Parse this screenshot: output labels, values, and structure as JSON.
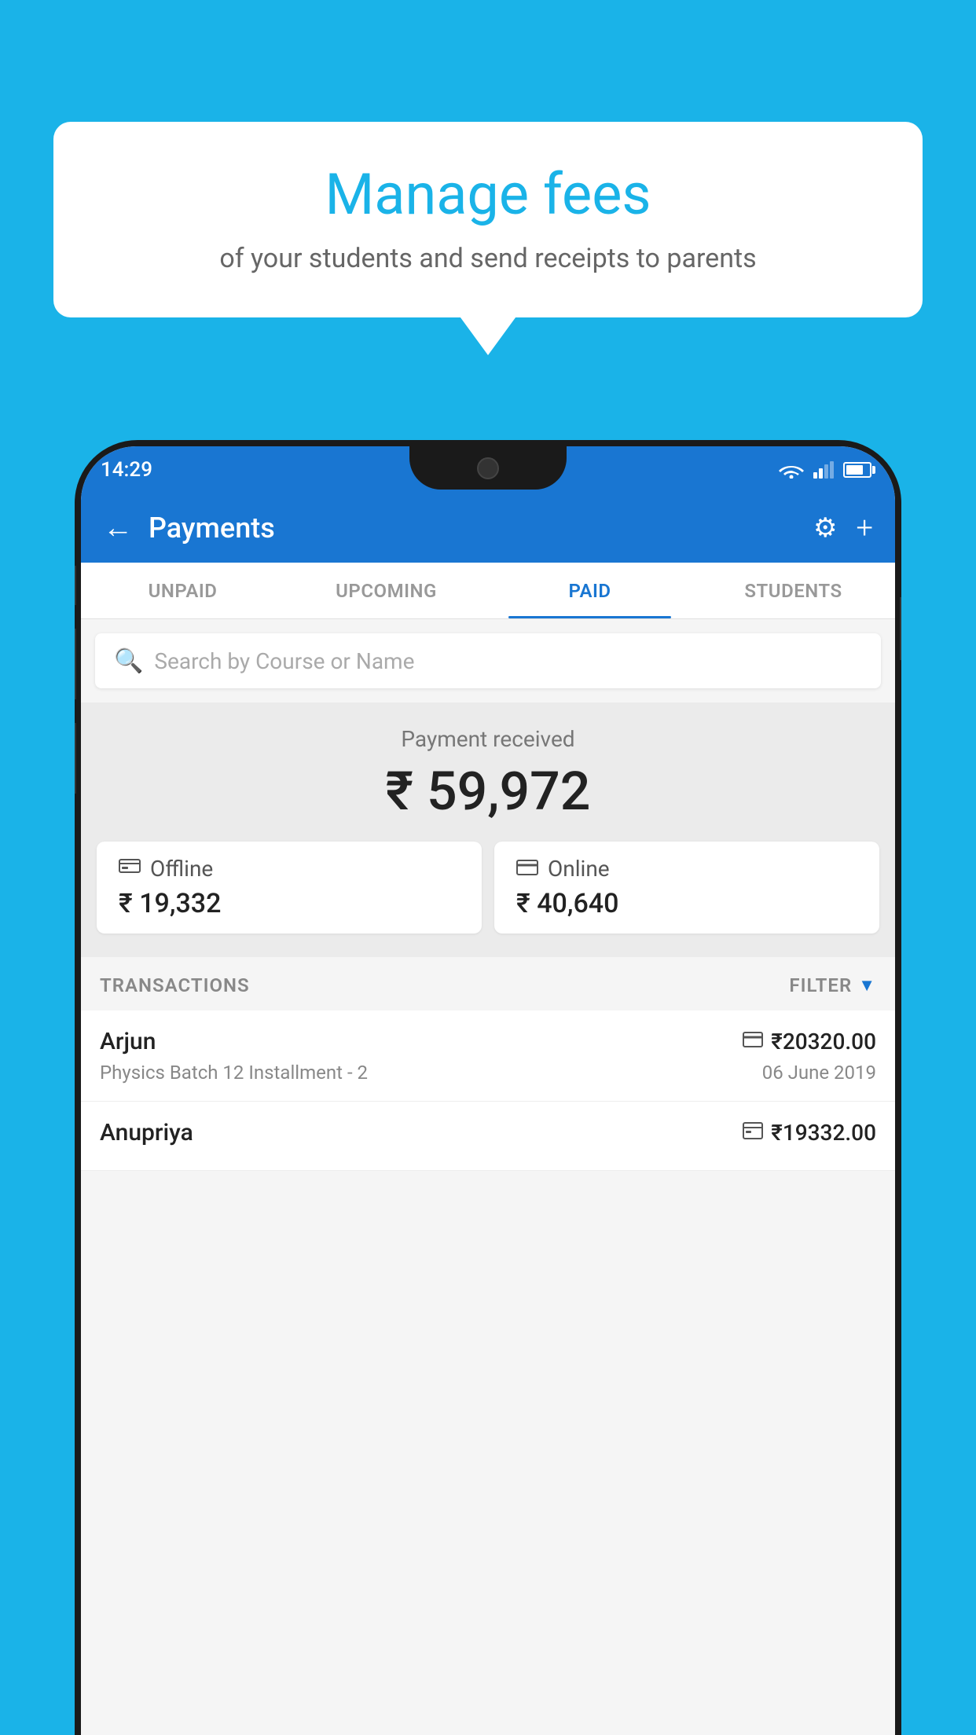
{
  "background_color": "#1ab3e8",
  "speech_bubble": {
    "title": "Manage fees",
    "subtitle": "of your students and send receipts to parents"
  },
  "status_bar": {
    "time": "14:29"
  },
  "header": {
    "title": "Payments",
    "back_label": "←",
    "gear_label": "⚙",
    "plus_label": "+"
  },
  "tabs": [
    {
      "id": "unpaid",
      "label": "UNPAID",
      "active": false
    },
    {
      "id": "upcoming",
      "label": "UPCOMING",
      "active": false
    },
    {
      "id": "paid",
      "label": "PAID",
      "active": true
    },
    {
      "id": "students",
      "label": "STUDENTS",
      "active": false
    }
  ],
  "search": {
    "placeholder": "Search by Course or Name"
  },
  "payment_received": {
    "label": "Payment received",
    "amount": "₹ 59,972",
    "offline": {
      "label": "Offline",
      "amount": "₹ 19,332"
    },
    "online": {
      "label": "Online",
      "amount": "₹ 40,640"
    }
  },
  "transactions": {
    "header": "TRANSACTIONS",
    "filter_label": "FILTER",
    "rows": [
      {
        "name": "Arjun",
        "description": "Physics Batch 12 Installment - 2",
        "amount": "₹20320.00",
        "date": "06 June 2019",
        "method": "card"
      },
      {
        "name": "Anupriya",
        "description": "",
        "amount": "₹19332.00",
        "date": "",
        "method": "cash"
      }
    ]
  }
}
